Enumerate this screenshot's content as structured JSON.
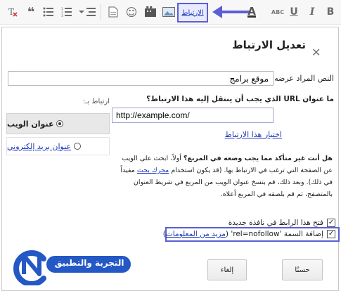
{
  "toolbar": {
    "link_button_label": "الارتباط",
    "font_size_label": "ABC",
    "underline_label": "U",
    "italic_label": "I",
    "bold_label": "B",
    "color_letter": "A",
    "accent_color": "#5a5fd6"
  },
  "dialog": {
    "title": "تعديل الارتباط",
    "text_to_display_label": "النص المراد عرضه:",
    "text_to_display_value": "موقع برامج",
    "link_to_label": "ارتباط بـ:",
    "link_options": [
      {
        "label": "عنوان الويب",
        "selected": true
      },
      {
        "label": "عنوان بريد إلكتروني",
        "selected": false
      }
    ],
    "url_question": "ما عنوان URL الذي يجب أن ينتقل إليه هذا الارتباط؟",
    "url_value": "http://example.com/",
    "test_link": "اختبار هذا الارتباط",
    "help_bold": "هل أنت غير متأكد مما يجب وضعه في المربع؟",
    "help_part1": "أولاً، ابحث على الويب عن الصفحة التي ترغب في الارتباط بها. (قد يكون استخدام",
    "help_link": "محرك بحث",
    "help_part2": "مفيداً في ذلك). وبعد ذلك، قم بنسخ عنوان الويب من المربع في شريط العنوان بالمتصفح، ثم قم بلصقه في المربع أعلاه.",
    "open_new_window_label": "فتح هذا الرابط في نافذة جديدة",
    "open_new_window_checked": true,
    "nofollow_label_prefix": "إضافة السمة 'rel=nofollow' (",
    "nofollow_link": "مزيد من المعلومات",
    "nofollow_label_suffix": ")",
    "nofollow_checked": true,
    "ok_label": "حسنًا",
    "cancel_label": "إلغاء"
  },
  "watermark": {
    "text": "التجربة والتطبيق"
  }
}
